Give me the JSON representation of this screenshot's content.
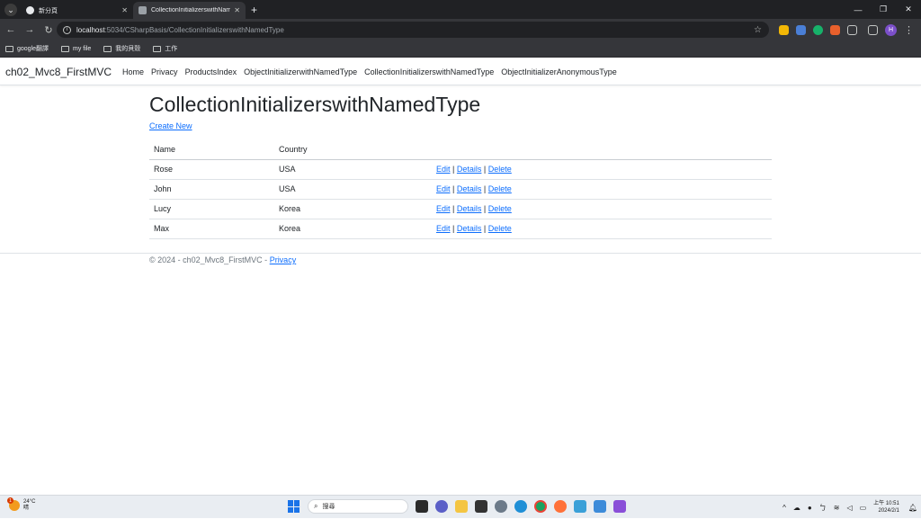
{
  "browser": {
    "tabs": [
      {
        "label": "新分頁",
        "active": false
      },
      {
        "label": "CollectionInitializerswithNam",
        "active": true
      }
    ],
    "url_host": "localhost",
    "url_path": ":5034/CSharpBasis/CollectionInitializerswithNamedType",
    "profile_initial": "H",
    "bookmarks": [
      "google翻譯",
      "my file",
      "我的貝殼",
      "工作"
    ]
  },
  "app": {
    "brand": "ch02_Mvc8_FirstMVC",
    "nav": [
      "Home",
      "Privacy",
      "ProductsIndex",
      "ObjectInitializerwithNamedType",
      "CollectionInitializerswithNamedType",
      "ObjectInitializerAnonymousType"
    ]
  },
  "main": {
    "title": "CollectionInitializerswithNamedType",
    "create_link": "Create New",
    "table": {
      "headers": [
        "Name",
        "Country",
        ""
      ],
      "rows": [
        {
          "name": "Rose",
          "country": "USA"
        },
        {
          "name": "John",
          "country": "USA"
        },
        {
          "name": "Lucy",
          "country": "Korea"
        },
        {
          "name": "Max",
          "country": "Korea"
        }
      ],
      "actions": {
        "edit": "Edit",
        "details": "Details",
        "delete": "Delete",
        "sep": "|"
      }
    }
  },
  "footer": {
    "text": "© 2024 - ch02_Mvc8_FirstMVC - ",
    "privacy": "Privacy"
  },
  "taskbar": {
    "weather_temp": "24°C",
    "weather_desc": "晴",
    "weather_badge": "1",
    "search_placeholder": "搜尋",
    "clock_time": "上午 10:51",
    "clock_date": "2024/2/1",
    "tray_lang": "ㄅ"
  },
  "colors": {
    "link": "#0d6efd",
    "chrome_dark": "#202124",
    "chrome_toolbar": "#35363a"
  }
}
